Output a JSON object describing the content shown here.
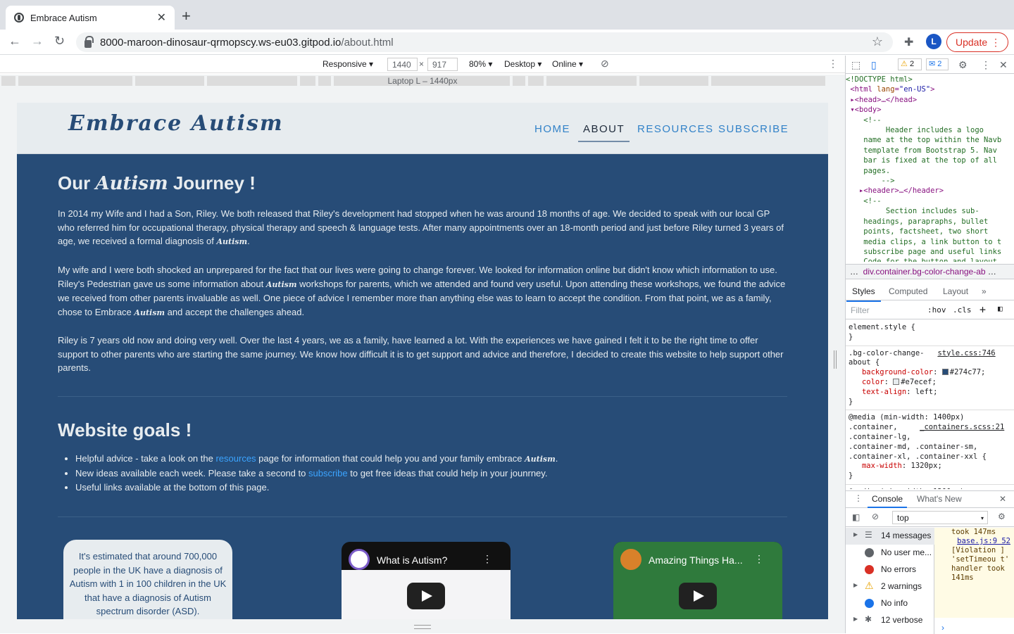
{
  "browser": {
    "tab_title": "Embrace Autism",
    "url_host": "8000-maroon-dinosaur-qrmopscy.ws-eu03.gitpod.io",
    "url_path": "/about.html",
    "profile_initial": "L",
    "update_label": "Update"
  },
  "device_toolbar": {
    "device": "Responsive ▾",
    "width": "1440",
    "height": "917",
    "zoom": "80% ▾",
    "mode": "Desktop ▾",
    "network": "Online ▾",
    "media_label": "Laptop L – 1440px"
  },
  "site": {
    "logo": "Embrace Autism",
    "nav": [
      "HOME",
      "ABOUT",
      "RESOURCES",
      "SUBSCRIBE"
    ],
    "h1_pre": "Our",
    "h1_em": "Autism",
    "h1_post": "Journey !",
    "p1": "In 2014 my Wife and I had a Son, Riley. We both released that Riley's development had stopped when he was around 18 months of age. We decided to speak with our local GP who referred him for occupational therapy, physical therapy and speech & language tests. After many appointments over an 18-month period and just before Riley turned 3 years of age, we received a formal diagnosis of",
    "p1_em": "Autism",
    "p1_end": ".",
    "p2a": "My wife and I were both shocked an unprepared for the fact that our lives were going to change forever. We looked for information online but didn't know which information to use. Riley's Pedestrian gave us some information about",
    "p2_em1": "Autism",
    "p2b": "workshops for parents, which we attended and found very useful. Upon attending these workshops, we found the advice we received from other parents invaluable as well. One piece of advice I remember more than anything else was to learn to accept the condition. From that point, we as a family, chose to Embrace",
    "p2_em2": "Autism",
    "p2c": "and accept the challenges ahead.",
    "p3": "Riley is 7 years old now and doing very well. Over the last 4 years, we as a family, have learned a lot. With the experiences we have gained I felt it to be the right time to offer support to other parents who are starting the same journey. We know how difficult it is to get support and advice and therefore, I decided to create this website to help support other parents.",
    "h2": "Website goals !",
    "goal1_a": "Helpful advice - take a look on the",
    "goal1_link": "resources",
    "goal1_b": "page for information that could help you and your family embrace",
    "goal1_em": "Autism",
    "goal1_end": ".",
    "goal2_a": "New ideas available each week. Please take a second to",
    "goal2_link": "subscribe",
    "goal2_b": "to get free ideas that could help in your jounrney.",
    "goal3": "Useful links available at the bottom of this page.",
    "fact": "It's estimated that around 700,000 people in the UK have a diagnosis of Autism with 1 in 100 children in the UK that have a diagnosis of Autism spectrum disorder (ASD).",
    "video1_title": "What is Autism?",
    "video2_title": "Amazing Things Ha..."
  },
  "devtools": {
    "warnings_badge": "2",
    "info_badge": "2",
    "breadcrumb": "div.container.bg-color-change-ab",
    "panel_tabs": [
      "Styles",
      "Computed",
      "Layout",
      "»"
    ],
    "filter_placeholder": "Filter",
    "hov": ":hov",
    "cls": ".cls",
    "rule1_src": "style.css:746",
    "rule2_src": "_containers.scss:21",
    "bg_value": "#274c77",
    "color_value": "#e7ecef",
    "console_tabs": [
      "Console",
      "What's New"
    ],
    "context": "top",
    "sidebar": [
      {
        "label": "14 messages",
        "icon": "list-icon"
      },
      {
        "label": "No user me...",
        "icon": "user-icon"
      },
      {
        "label": "No errors",
        "icon": "error-icon"
      },
      {
        "label": "2 warnings",
        "icon": "warning-icon"
      },
      {
        "label": "No info",
        "icon": "info-icon"
      },
      {
        "label": "12 verbose",
        "icon": "bug-icon"
      }
    ],
    "log": {
      "took1": "took 147ms",
      "src": "base.js:9 52",
      "violation": "[Violation ] 'setTimeou t' handler took 141ms"
    }
  }
}
